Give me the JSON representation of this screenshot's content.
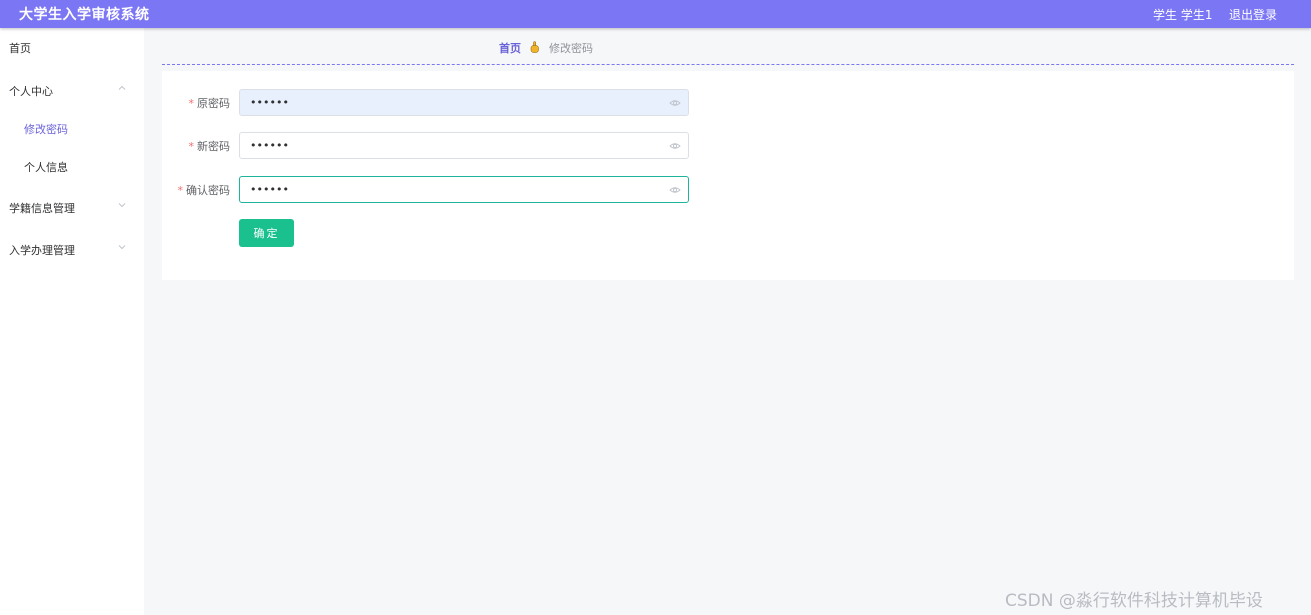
{
  "header": {
    "title": "大学生入学审核系统",
    "user": "学生 学生1",
    "logout": "退出登录",
    "bg_color": "#7b76f4"
  },
  "sidebar": {
    "items": [
      {
        "label": "首页"
      },
      {
        "label": "个人中心",
        "chevron": "chevron-up-icon"
      },
      {
        "label": "修改密码"
      },
      {
        "label": "个人信息"
      },
      {
        "label": "学籍信息管理",
        "chevron": "chevron-down-icon"
      },
      {
        "label": "入学办理管理",
        "chevron": "chevron-down-icon"
      }
    ]
  },
  "breadcrumb": {
    "home": "首页",
    "current": "修改密码",
    "separator_icon": "hand-icon"
  },
  "form": {
    "fields": [
      {
        "label": "原密码",
        "value": "123456",
        "required": "*"
      },
      {
        "label": "新密码",
        "value": "123456",
        "required": "*"
      },
      {
        "label": "确认密码",
        "value": "123456",
        "required": "*"
      }
    ],
    "submit_label": "确定",
    "accent_color": "#1ac08e",
    "toggle_icon": "eye-icon"
  },
  "watermark": "CSDN @淼行软件科技计算机毕设"
}
